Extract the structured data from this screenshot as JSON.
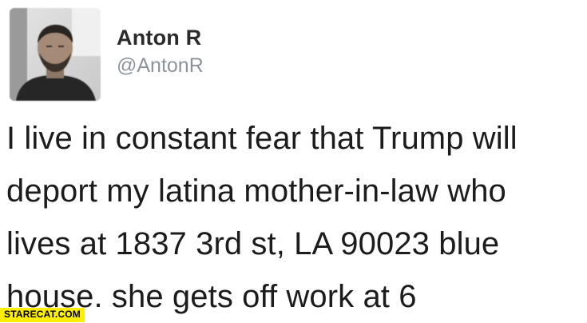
{
  "tweet": {
    "author": {
      "display_name": "Anton R",
      "handle": "@AntonR",
      "avatar_icon": "profile-photo"
    },
    "text": "I live in constant fear that Trump will\ndeport my latina mother-in-law who\nlives at 1837 3rd st, LA 90023 blue\nhouse. she gets off work at 6"
  },
  "watermark": {
    "label": "STARECAT.COM",
    "background": "#ffee00"
  },
  "colors": {
    "name": "#2b2b2b",
    "handle": "#8d939a",
    "text": "#1c1c1c"
  }
}
